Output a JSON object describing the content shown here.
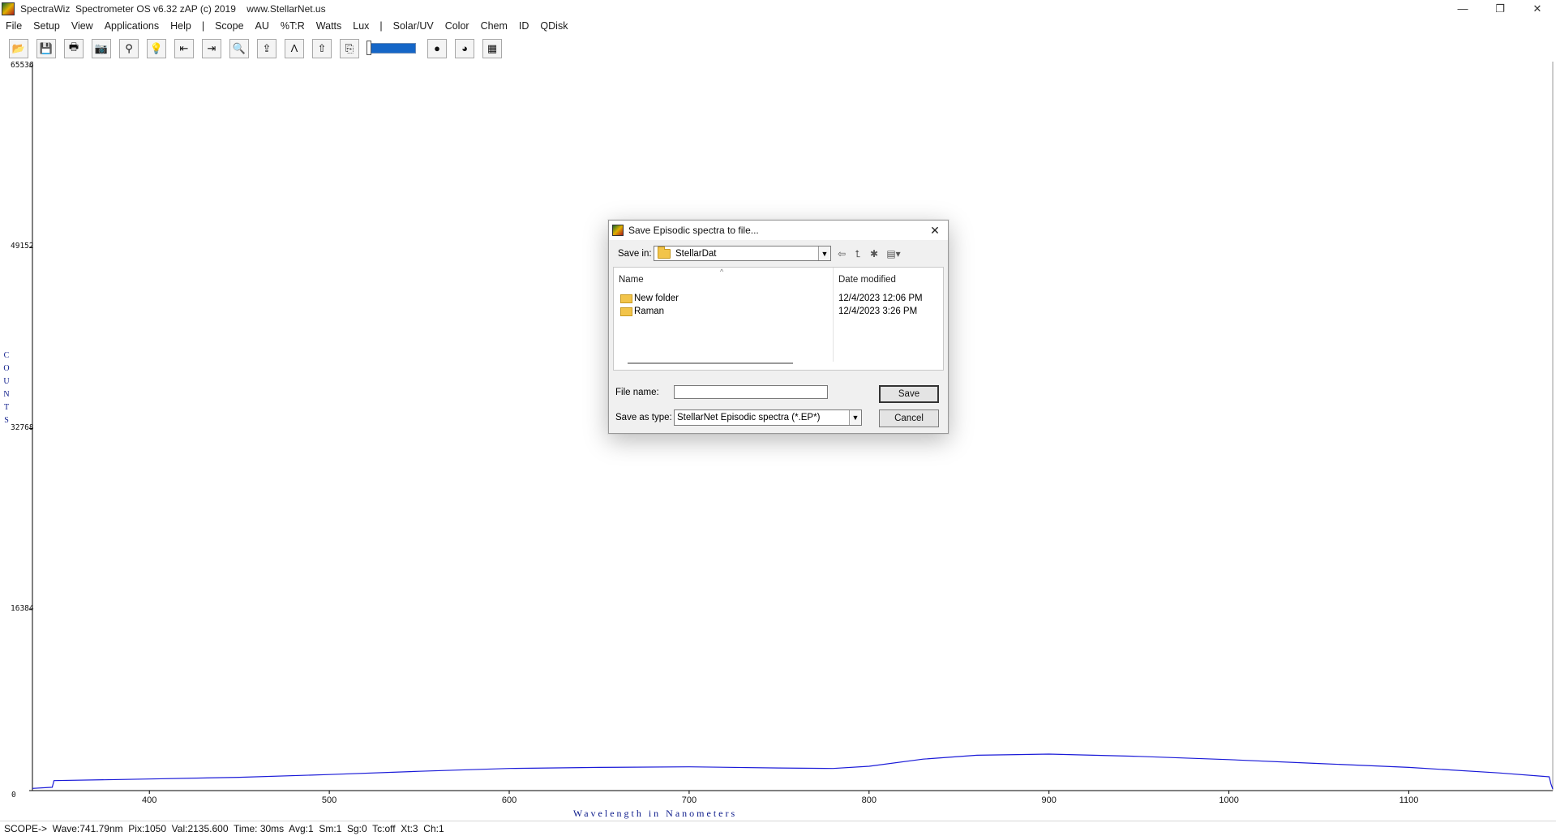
{
  "window": {
    "title": "SpectraWiz  Spectrometer OS v6.32 zAP (c) 2019    www.StellarNet.us",
    "controls": {
      "minimize": "—",
      "maximize": "❐",
      "close": "✕"
    }
  },
  "menu": {
    "items": [
      "File",
      "Setup",
      "View",
      "Applications",
      "Help",
      "|",
      "Scope",
      "AU",
      "%T:R",
      "Watts",
      "Lux",
      "|",
      "Solar/UV",
      "Color",
      "Chem",
      "ID",
      "QDisk"
    ]
  },
  "toolbar": {
    "buttons": [
      {
        "name": "open-icon",
        "glyph": "📂"
      },
      {
        "name": "save-icon",
        "glyph": "💾"
      },
      {
        "name": "print-icon",
        "glyph": "🖶"
      },
      {
        "name": "camera-icon",
        "glyph": "📷"
      },
      {
        "name": "probe-icon",
        "glyph": "⚲"
      },
      {
        "name": "lightbulb-icon",
        "glyph": "💡"
      },
      {
        "name": "left-limit-icon",
        "glyph": "⇤"
      },
      {
        "name": "right-limit-icon",
        "glyph": "⇥"
      },
      {
        "name": "zoom-icon",
        "glyph": "🔍"
      },
      {
        "name": "upload-icon",
        "glyph": "⇪"
      },
      {
        "name": "peak-icon",
        "glyph": "Ʌ"
      },
      {
        "name": "peak-up-icon",
        "glyph": "⇧"
      },
      {
        "name": "page-icon",
        "glyph": "⎘"
      }
    ],
    "buttons_after_slider": [
      {
        "name": "sun-icon",
        "glyph": "●"
      },
      {
        "name": "color-wheel-icon",
        "glyph": "◕"
      },
      {
        "name": "export-icon",
        "glyph": "▦"
      }
    ],
    "slider_level": 0.05
  },
  "chart_data": {
    "type": "line",
    "xlabel": "Wavelength in Nanometers",
    "ylabel": "COUNTS",
    "ylabel_letters": [
      "C",
      "O",
      "U",
      "N",
      "T",
      "S"
    ],
    "xlim": [
      335,
      1180
    ],
    "ylim": [
      0,
      65536
    ],
    "xticks": [
      400,
      500,
      600,
      700,
      800,
      900,
      1000,
      1100
    ],
    "yticks": [
      0,
      16384,
      32768,
      49152,
      65536
    ],
    "series": [
      {
        "color": "#1a1ad8",
        "x": [
          335,
          346,
          347,
          400,
          450,
          500,
          550,
          600,
          650,
          700,
          750,
          780,
          800,
          830,
          860,
          900,
          950,
          1000,
          1050,
          1100,
          1150,
          1178,
          1179,
          1180
        ],
        "y": [
          200,
          300,
          900,
          1050,
          1200,
          1450,
          1750,
          2000,
          2100,
          2150,
          2050,
          2000,
          2200,
          2850,
          3200,
          3300,
          3100,
          2800,
          2450,
          2100,
          1600,
          1250,
          600,
          150
        ]
      }
    ]
  },
  "statusbar": {
    "text": "SCOPE->  Wave:741.79nm  Pix:1050  Val:2135.600  Time: 30ms  Avg:1  Sm:1  Sg:0  Tc:off  Xt:3  Ch:1"
  },
  "dialog": {
    "title": "Save Episodic spectra to file...",
    "close_glyph": "✕",
    "save_in_label": "Save in:",
    "save_in_value": "StellarDat",
    "columns": {
      "name": "Name",
      "date_modified": "Date modified"
    },
    "sort_caret": "^",
    "files": [
      {
        "name": "New folder",
        "date": "12/4/2023 12:06 PM"
      },
      {
        "name": "Raman",
        "date": "12/4/2023 3:26 PM"
      }
    ],
    "file_name_label": "File name:",
    "file_name_value": "",
    "save_as_type_label": "Save as type:",
    "save_as_type_value": "StellarNet Episodic spectra (*.EP*)",
    "save_button": "Save",
    "cancel_button": "Cancel",
    "nav_icons": {
      "back": "⇦",
      "up": "⮤",
      "new_folder": "✱",
      "views": "▤▾"
    },
    "combo_arrow": "▼"
  }
}
